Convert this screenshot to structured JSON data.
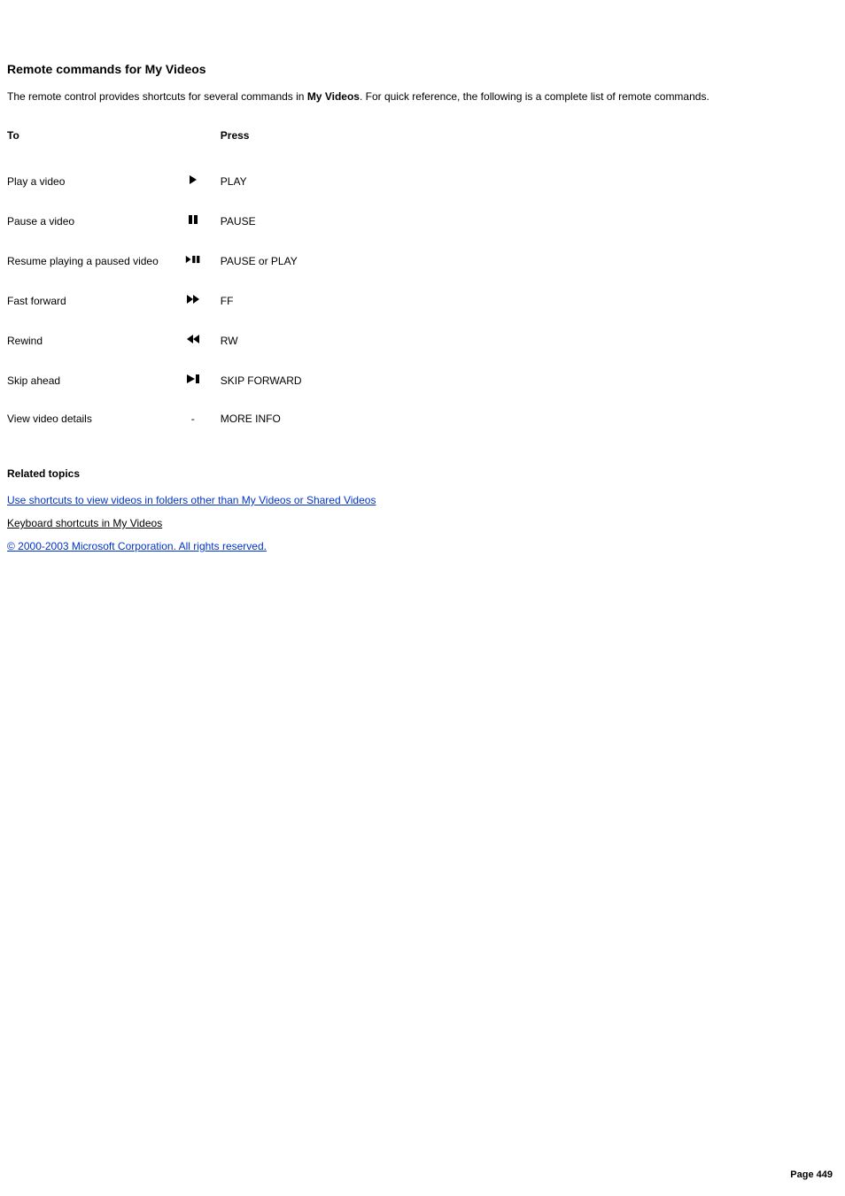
{
  "heading": "Remote commands for My Videos",
  "intro_pre": "The remote control provides shortcuts for several commands in ",
  "intro_bold": "My Videos",
  "intro_post": ". For quick reference, the following is a complete list of remote commands.",
  "table": {
    "header_to": "To",
    "header_press": "Press",
    "rows": [
      {
        "to": "Play a video",
        "icon": "play",
        "press": "PLAY"
      },
      {
        "to": "Pause a video",
        "icon": "pause",
        "press": "PAUSE"
      },
      {
        "to": "Resume playing a paused video",
        "icon": "play-pause",
        "press": "PAUSE or PLAY"
      },
      {
        "to": "Fast forward",
        "icon": "ff",
        "press": "FF"
      },
      {
        "to": "Rewind",
        "icon": "rw",
        "press": "RW"
      },
      {
        "to": "Skip ahead",
        "icon": "skip-forward",
        "press": "SKIP FORWARD"
      },
      {
        "to": "View video details",
        "icon": "dash",
        "press": "MORE INFO"
      }
    ]
  },
  "related_heading": "Related topics",
  "links": {
    "shortcuts": "Use shortcuts to view videos in folders other than My Videos or Shared Videos",
    "keyboard": "Keyboard shortcuts in My Videos",
    "copyright": "© 2000-2003 Microsoft Corporation. All rights reserved."
  },
  "footer": "Page 449"
}
